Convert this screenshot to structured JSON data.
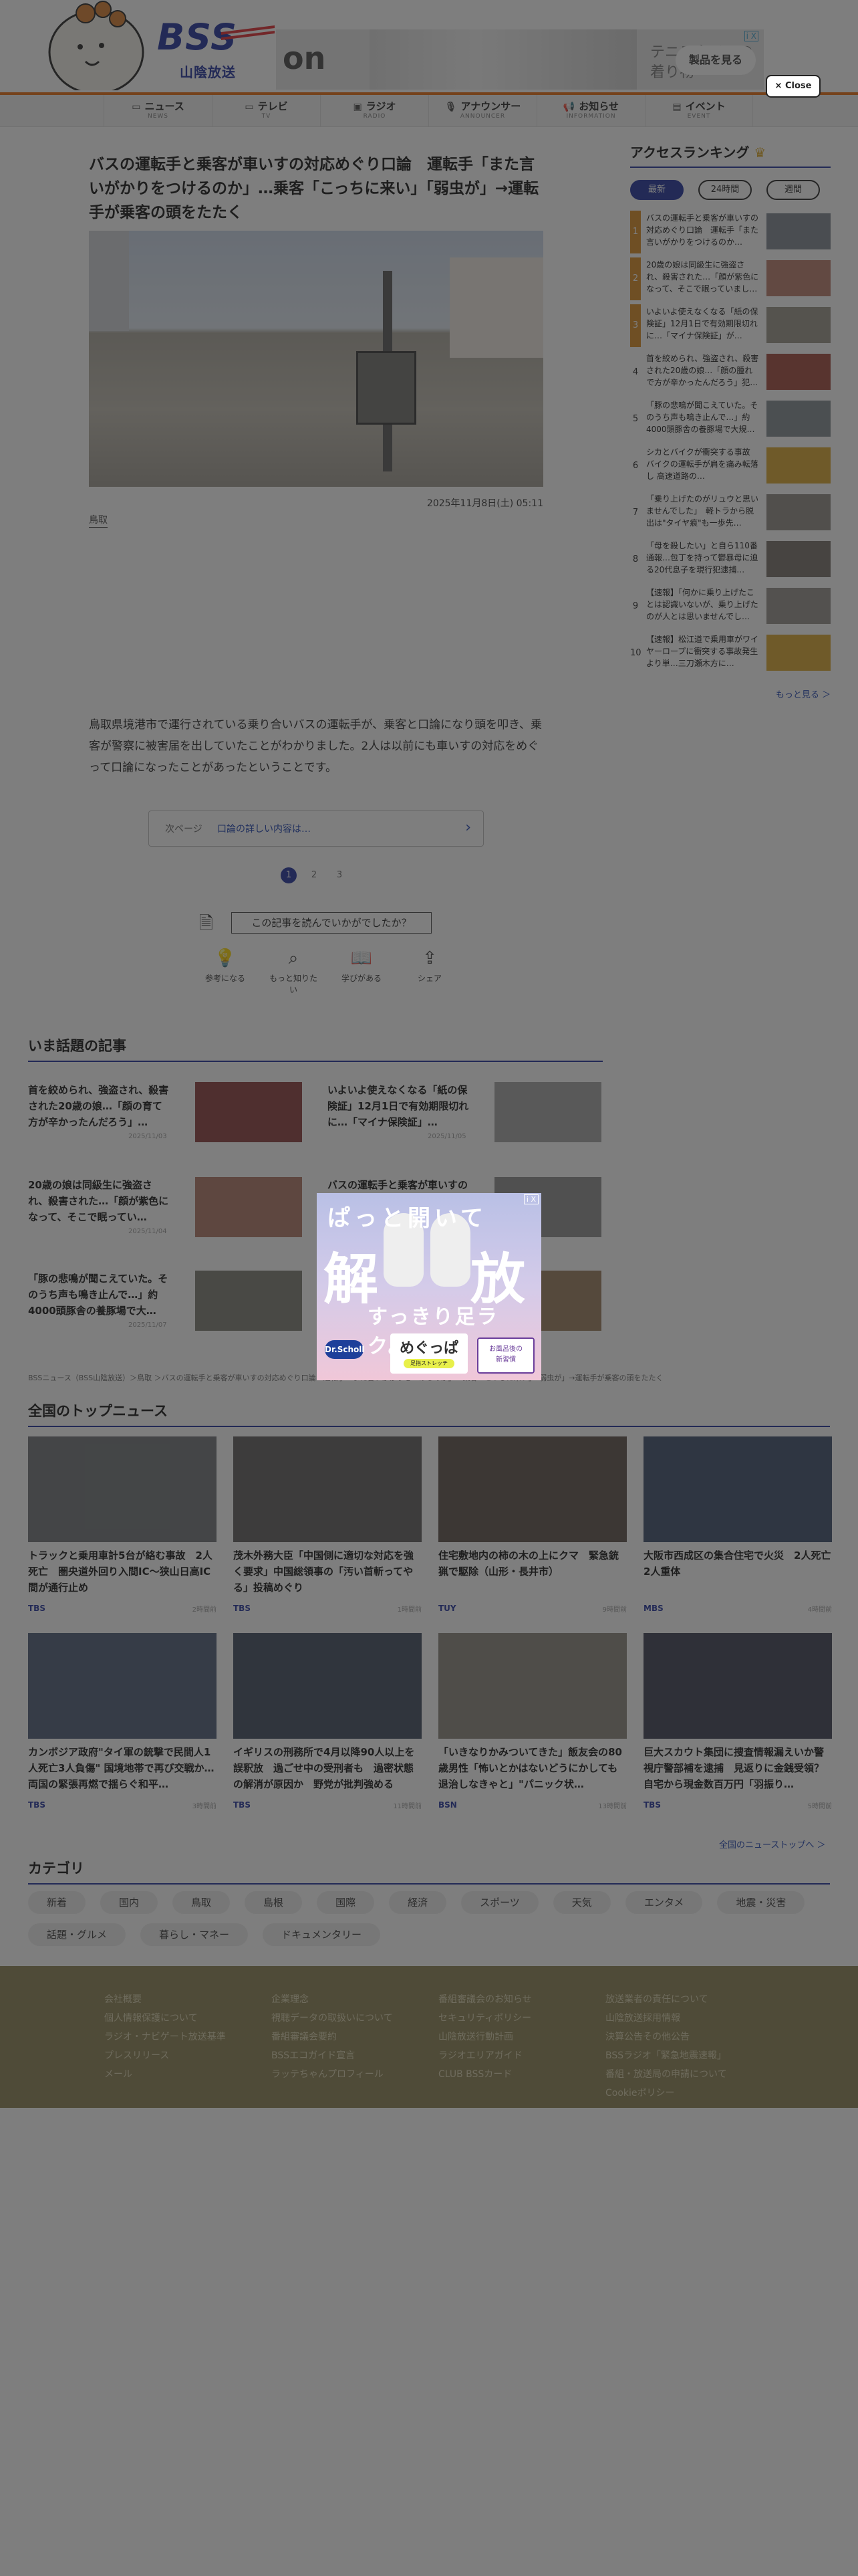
{
  "header": {
    "logo_text": "BSS",
    "logo_sub": "山陰放送",
    "ad": {
      "brand": "on",
      "copy_line1": "テニスタイルの",
      "copy_line2": "着り物",
      "cta": "製品を見る",
      "ad_mark": "i X"
    },
    "close_label": "×  Close"
  },
  "nav": [
    {
      "label": "ニュース",
      "sub": "NEWS",
      "icon": "news-icon"
    },
    {
      "label": "テレビ",
      "sub": "TV",
      "icon": "tv-icon"
    },
    {
      "label": "ラジオ",
      "sub": "RADIO",
      "icon": "radio-icon"
    },
    {
      "label": "アナウンサー",
      "sub": "ANNOUNCER",
      "icon": "microphone-icon"
    },
    {
      "label": "お知らせ",
      "sub": "INFORMATION",
      "icon": "megaphone-icon"
    },
    {
      "label": "イベント",
      "sub": "EVENT",
      "icon": "ticket-icon"
    }
  ],
  "article": {
    "title": "バスの運転手と乗客が車いすの対応めぐり口論　運転手「また言いがかりをつけるのか」…乗客「こっちに来い」「弱虫が」→運転手が乗客の頭をたたく",
    "date": "2025年11月8日(土) 05:11",
    "tag": "鳥取",
    "body": "鳥取県境港市で運行されている乗り合いバスの運転手が、乗客と口論になり頭を叩き、乗客が警察に被害届を出していたことがわかりました。2人は以前にも車いすの対応をめぐって口論になったことがあったということです。",
    "next_label": "次ページ",
    "next_link": "口論の詳しい内容は…",
    "pages": [
      "1",
      "2",
      "3"
    ],
    "survey_question": "この記事を読んでいかがでしたか？",
    "reactions": [
      "参考になる",
      "もっと知りたい",
      "学びがある",
      "シェア"
    ]
  },
  "ranking": {
    "title": "アクセスランキング",
    "tabs": [
      "最新",
      "24時間",
      "週間"
    ],
    "items": [
      {
        "n": "1",
        "text": "バスの運転手と乗客が車いすの対応めぐり口論　運転手「また言いがかりをつけるのか…"
      },
      {
        "n": "2",
        "text": "20歳の娘は同級生に強盗され、殺害された…「顔が紫色になって、そこで眠っていまし…"
      },
      {
        "n": "3",
        "text": "いよいよ使えなくなる「紙の保険証」12月1日で有効期限切れに…「マイナ保険証」が…"
      },
      {
        "n": "4",
        "text": "首を絞められ、強盗され、殺害された20歳の娘…「顔の腫れで方が辛かったんだろう」犯…"
      },
      {
        "n": "5",
        "text": "「豚の悲鳴が聞こえていた。そのうち声も鳴き止んで…」約4000頭豚舎の養豚場で大規…"
      },
      {
        "n": "6",
        "text": "シカとバイクが衝突する事故　バイクの運転手が肩を痛み転落し 高速道路の…"
      },
      {
        "n": "7",
        "text": "「乗り上げたのがリュウと思いませんでした」　軽トラから脱出は\"タイヤ痕\"も一歩先…"
      },
      {
        "n": "8",
        "text": "「母を殺したい」と自ら110番通報…包丁を持って鬱暴母に迫る20代息子を現行犯逮捕…"
      },
      {
        "n": "9",
        "text": "【速報】「何かに乗り上げたことは認識いないが、乗り上げたのが人とは思いませんでし…"
      },
      {
        "n": "10",
        "text": "【速報】松江道で乗用車がワイヤーロープに衝突する事故発生より単…三刀瀬木方に…"
      }
    ],
    "more": "もっと見る ＞"
  },
  "topics": {
    "title": "いま話題の記事",
    "items": [
      {
        "text": "首を絞められ、強盗され、殺害された20歳の娘…「顔の育て方が辛かったんだろう」…",
        "date": "2025/11/03"
      },
      {
        "text": "いよいよ使えなくなる「紙の保険証」12月1日で有効期限切れに…「マイナ保険証」…",
        "date": "2025/11/05"
      },
      {
        "text": "20歳の娘は同級生に強盗され、殺害された…「顔が紫色になって、そこで眠ってい…",
        "date": "2025/11/04"
      },
      {
        "text": "バスの運転手と乗客が車いすの対応めぐり口論…",
        "date": "2025/11/08"
      },
      {
        "text": "「豚の悲鳴が聞こえていた。そのうち声も鳴き止んで…」約4000頭豚舎の養豚場で大…",
        "date": "2025/11/07"
      },
      {
        "text": "",
        "date": ""
      }
    ]
  },
  "breadcrumb": "BSSニュース（BSS山陰放送）＞鳥取 ＞バスの運転手と乗客が車いすの対応めぐり口論　運転手「また言いがかりをつけるのか」…乗客「こっちに来い」「弱虫が」→運転手が乗客の頭をたたく",
  "national": {
    "title": "全国のトップニュース",
    "items": [
      {
        "text": "トラックと乗用車計5台が絡む事故　2人死亡　圏央道外回り入間IC〜狭山日高IC間が通行止め",
        "src": "TBS",
        "ago": "2時間前"
      },
      {
        "text": "茂木外務大臣「中国側に適切な対応を強く要求」中国総領事の「汚い首斬ってやる」投稿めぐり",
        "src": "TBS",
        "ago": "1時間前"
      },
      {
        "text": "住宅敷地内の柿の木の上にクマ　緊急銃猟で駆除（山形・長井市）",
        "src": "TUY",
        "ago": "9時間前"
      },
      {
        "text": "大阪市西成区の集合住宅で火災　2人死亡 2人重体",
        "src": "MBS",
        "ago": "4時間前"
      },
      {
        "text": "カンボジア政府\"タイ軍の銃撃で民間人1人死亡3人負傷\" 国境地帯で再び交戦か…両国の緊張再燃で揺らぐ和平…",
        "src": "TBS",
        "ago": "3時間前"
      },
      {
        "text": "イギリスの刑務所で4月以降90人以上を誤釈放　過ごせ中の受刑者も　過密状態の解消が原因か　野党が批判強める",
        "src": "TBS",
        "ago": "11時間前"
      },
      {
        "text": "「いきなりかみついてきた」飯友会の80歳男性「怖いとかはないどうにかしても退治しなきゃと」\"パニック状…",
        "src": "BSN",
        "ago": "13時間前"
      },
      {
        "text": "巨大スカウト集団に捜査情報漏えいか警視庁警部補を逮捕　見返りに金銭受領？自宅から現金数百万円「羽振り…",
        "src": "TBS",
        "ago": "5時間前"
      }
    ],
    "more": "全国のニューストップへ ＞"
  },
  "categories": {
    "title": "カテゴリ",
    "items": [
      "新着",
      "国内",
      "鳥取",
      "島根",
      "国際",
      "経済",
      "スポーツ",
      "天気",
      "エンタメ",
      "地震・災害",
      "話題・グルメ",
      "暮らし・マネー",
      "ドキュメンタリー"
    ]
  },
  "footer": {
    "col1": [
      "会社概要",
      "個人情報保護について",
      "ラジオ・ナビゲート放送基準",
      "プレスリリース",
      "メール"
    ],
    "col2": [
      "企業理念",
      "視聴データの取扱いについて",
      "番組審議会要約",
      "BSSエコガイド宣言",
      "ラッテちゃんプロフィール"
    ],
    "col3": [
      "番組審議会のお知らせ",
      "セキュリティポリシー",
      "山陰放送行動計画",
      "ラジオエリアガイド",
      "CLUB BSSカード"
    ],
    "col4": [
      "放送業者の責任について",
      "山陰放送採用情報",
      "決算公告その他公告",
      "BSSラジオ「緊急地震速報」",
      "番組・放送局の申請について",
      "Cookieポリシー"
    ]
  },
  "popup_ad": {
    "line1": "ぱっと開いて",
    "big1": "解",
    "big2": "放",
    "line3": "すっきり足ラク。",
    "brand": "Dr.Scholl",
    "product": "めぐっぱ",
    "product_sub": "足指ストレッチ",
    "new_line1": "お風呂後の",
    "new_line2": "新習慣",
    "ad_mark": "i X"
  }
}
